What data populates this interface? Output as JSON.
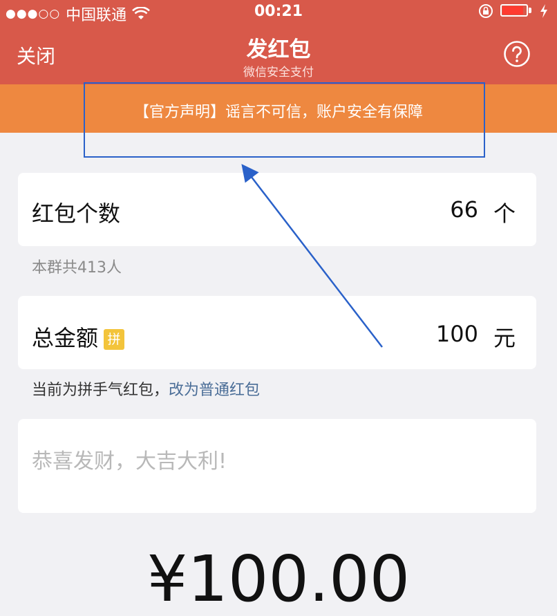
{
  "status_bar": {
    "signal_dots": "●●●○○",
    "carrier": "中国联通",
    "time": "00:21",
    "icons": [
      "wifi-icon",
      "orientation-lock-icon",
      "battery-icon",
      "charging-bolt-icon"
    ],
    "battery_color": "#ff3b30"
  },
  "nav": {
    "close_label": "关闭",
    "title": "发红包",
    "subtitle": "微信安全支付",
    "help_icon": "question-circle-icon"
  },
  "notice": {
    "text": "【官方声明】谣言不可信，账户安全有保障"
  },
  "form": {
    "count": {
      "label": "红包个数",
      "value": "66",
      "unit": "个"
    },
    "group_hint": "本群共413人",
    "total": {
      "label": "总金额",
      "badge": "拼",
      "value": "100",
      "unit": "元"
    },
    "mode_hint": "当前为拼手气红包，",
    "mode_link": "改为普通红包",
    "greeting_placeholder": "恭喜发财，大吉大利!",
    "amount_display": "¥100.00"
  },
  "colors": {
    "header_bg": "#d8594a",
    "notice_bg": "#ee8840",
    "badge_bg": "#f3c43b",
    "link": "#4a6d97",
    "annotation": "#2a61c9"
  }
}
